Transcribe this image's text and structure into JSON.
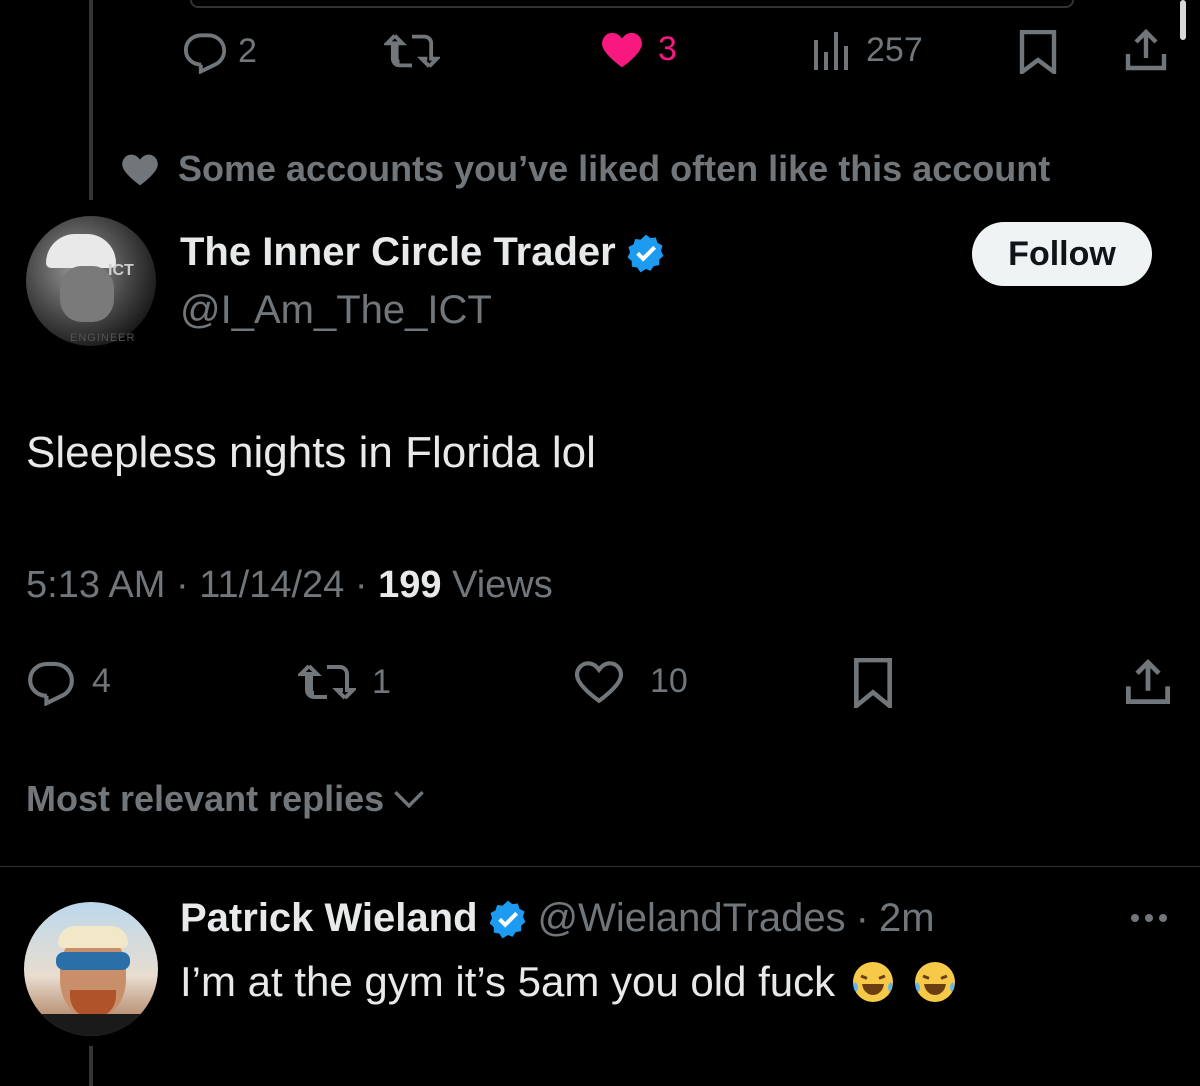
{
  "prev_tweet_actions": {
    "replies": "2",
    "retweets": "",
    "likes": "3",
    "views": "257",
    "like_color": "#f91880"
  },
  "social_context": "Some accounts you’ve liked often like this account",
  "main_tweet": {
    "display_name": "The Inner Circle Trader",
    "handle": "@I_Am_The_ICT",
    "follow_label": "Follow",
    "avatar_text": "ENGINEER",
    "avatar_badge_text": "ICT",
    "text": "Sleepless nights in Florida lol",
    "time": "5:13 AM",
    "date": "11/14/24",
    "views_count": "199",
    "views_label": "Views",
    "replies": "4",
    "retweets": "1",
    "likes": "10"
  },
  "replies_sort": {
    "label": "Most relevant replies"
  },
  "reply": {
    "display_name": "Patrick Wieland",
    "handle": "@WielandTrades",
    "time": "2m",
    "text": "I’m at the gym it’s 5am you old fuck",
    "emojis": [
      "face-with-tears-of-joy",
      "face-with-tears-of-joy"
    ]
  },
  "colors": {
    "background": "#000000",
    "text_primary": "#e7e9ea",
    "text_secondary": "#71767b",
    "verified_blue": "#1d9bf0",
    "like_pink": "#f91880"
  },
  "separator": "·"
}
